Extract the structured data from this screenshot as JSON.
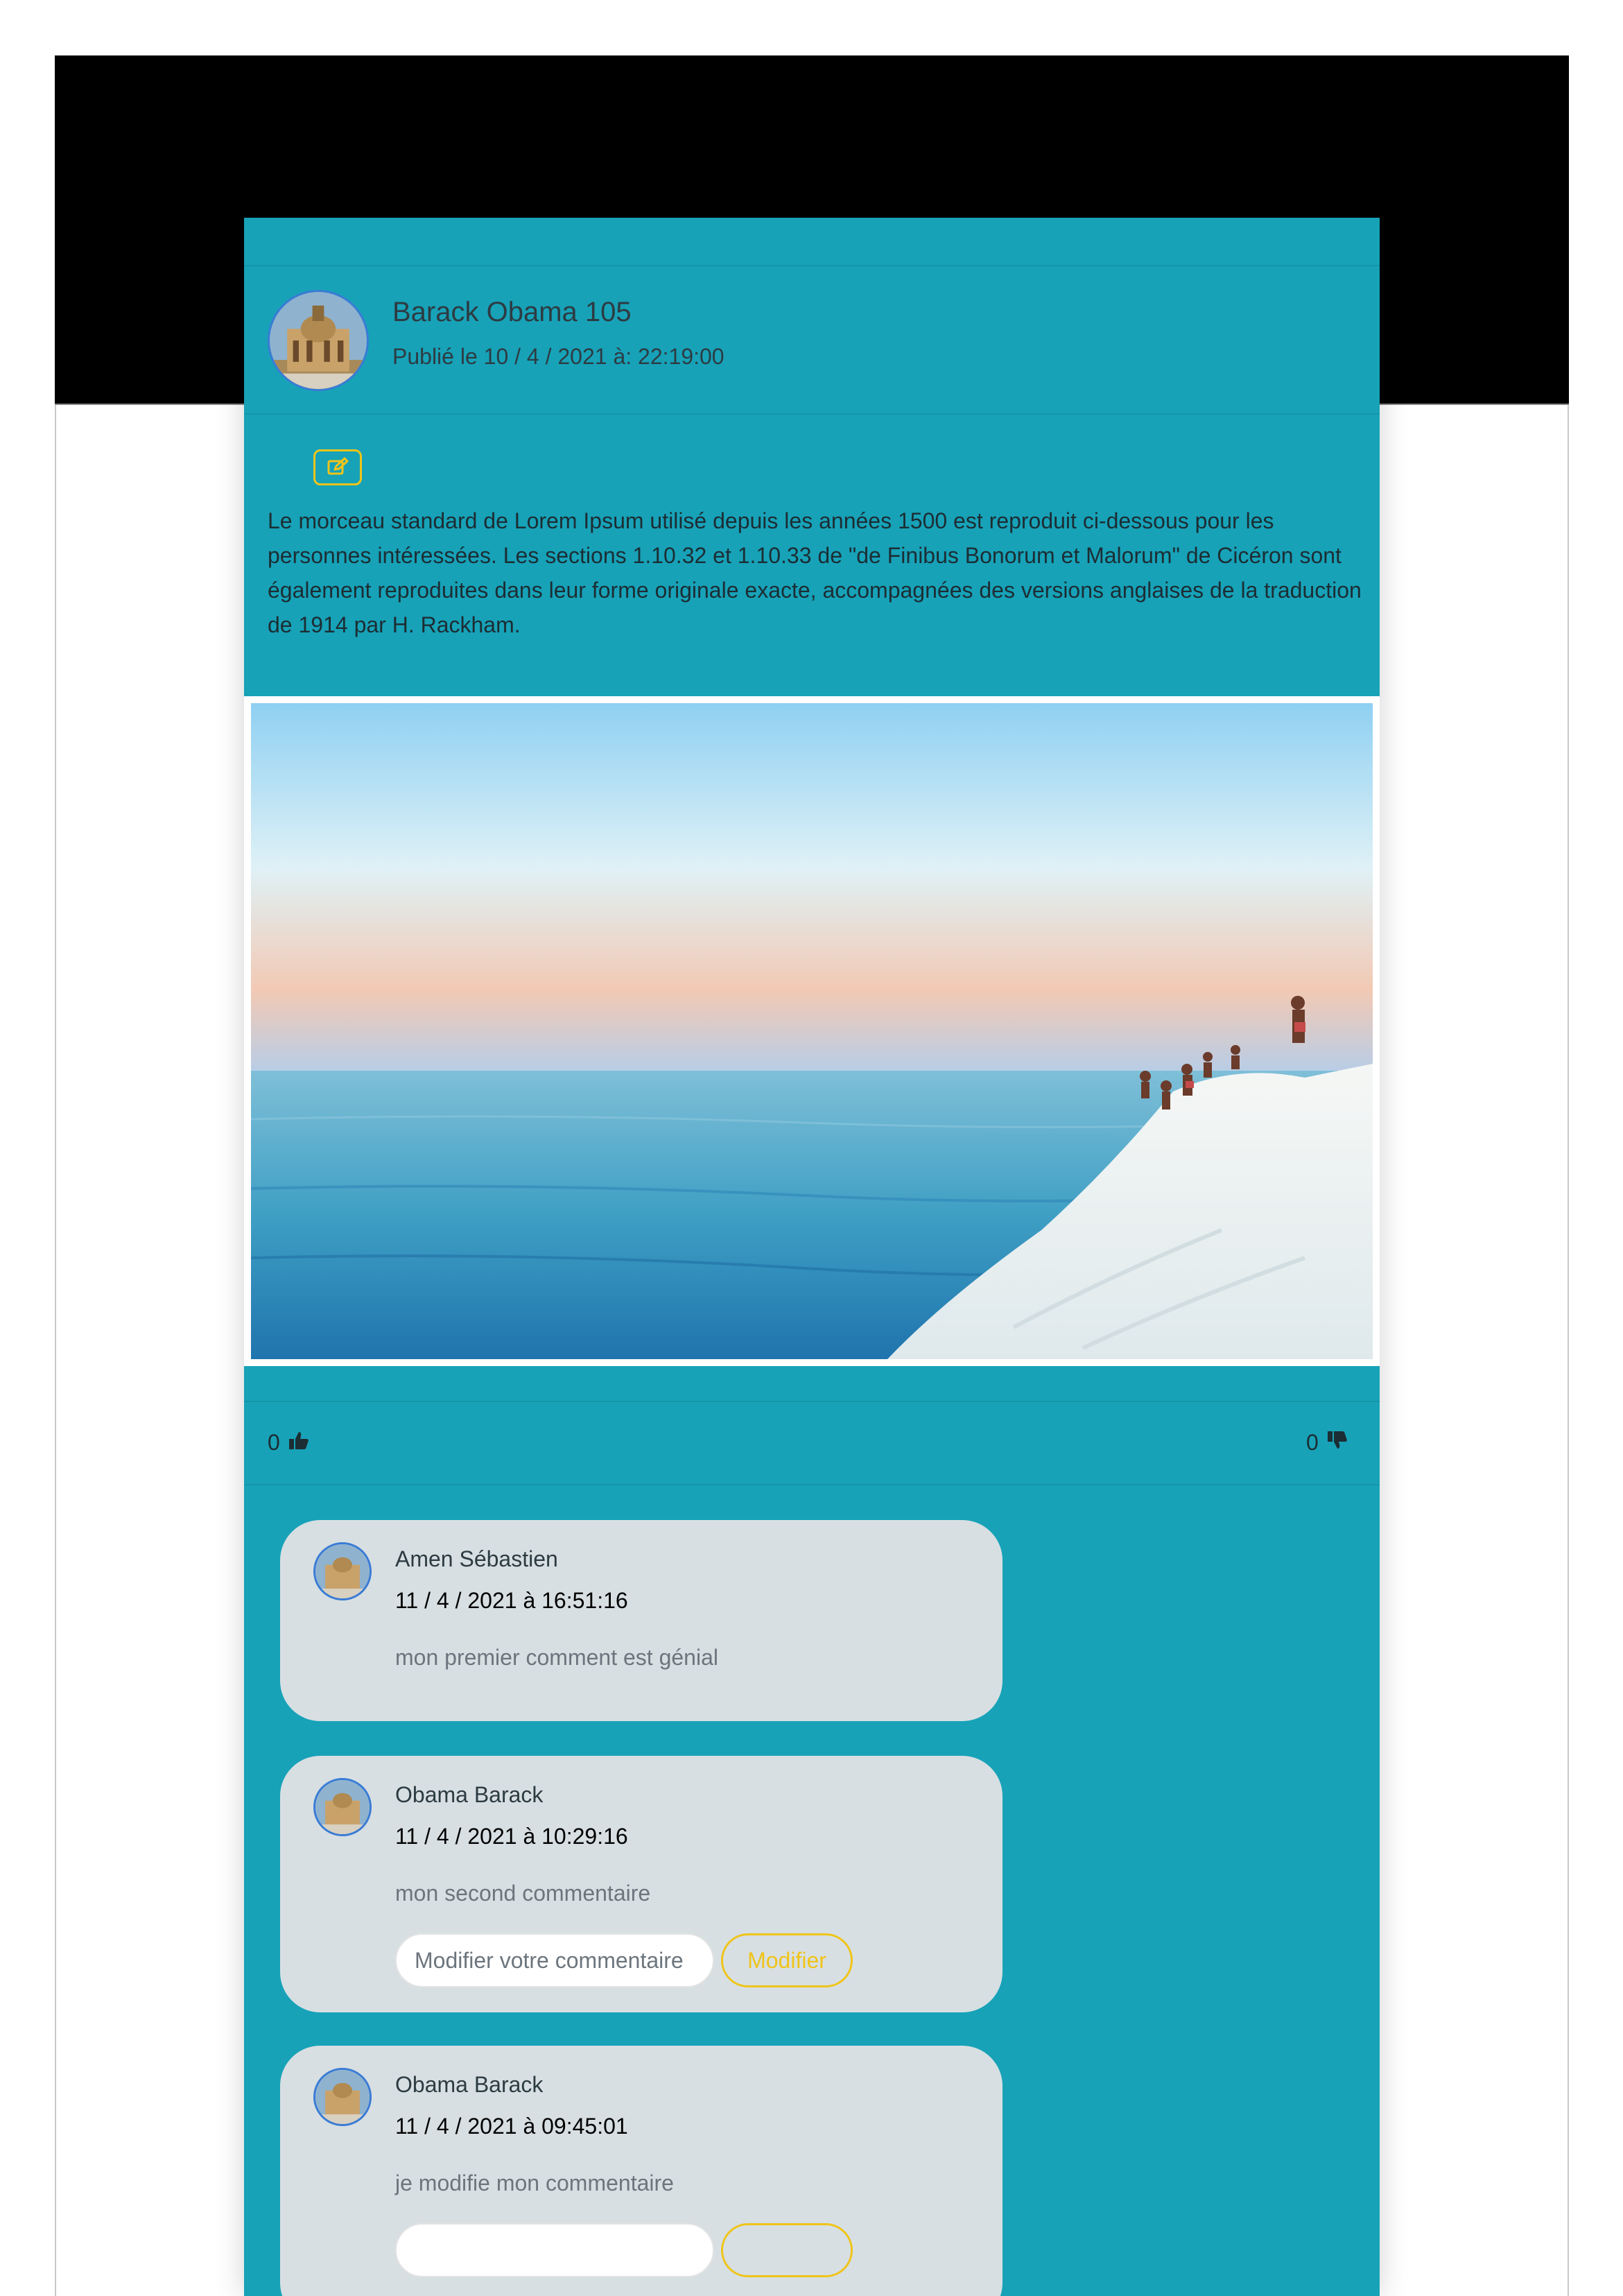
{
  "post": {
    "author": "Barack Obama 105",
    "published": "Publié le 10 / 4 / 2021 à: 22:19:00",
    "body": "Le morceau standard de Lorem Ipsum utilisé depuis les années 1500 est reproduit ci-dessous pour les personnes intéressées. Les sections 1.10.32 et 1.10.33 de \"de Finibus Bonorum et Malorum\" de Cicéron sont également reproduites dans leur forme originale exacte, accompagnées des versions anglaises de la traduction de 1914 par H. Rackham.",
    "edit_icon": "edit-icon",
    "likes": "0",
    "dislikes": "0"
  },
  "comments": [
    {
      "author": "Amen Sébastien",
      "date": "11 / 4 / 2021 à 16:51:16",
      "text": "mon premier comment est génial"
    },
    {
      "author": "Obama Barack",
      "date": "11 / 4 / 2021 à 10:29:16",
      "text": "mon second commentaire",
      "input_placeholder": "Modifier votre commentaire",
      "button_label": "Modifier"
    },
    {
      "author": "Obama Barack",
      "date": "11 / 4 / 2021 à 09:45:01",
      "text": "je modifie mon commentaire",
      "input_placeholder": "",
      "button_label": ""
    }
  ],
  "colors": {
    "card": "#17a2b8",
    "comment_bg": "#d7dfe2",
    "accent": "#f0c419",
    "header": "#000000"
  }
}
